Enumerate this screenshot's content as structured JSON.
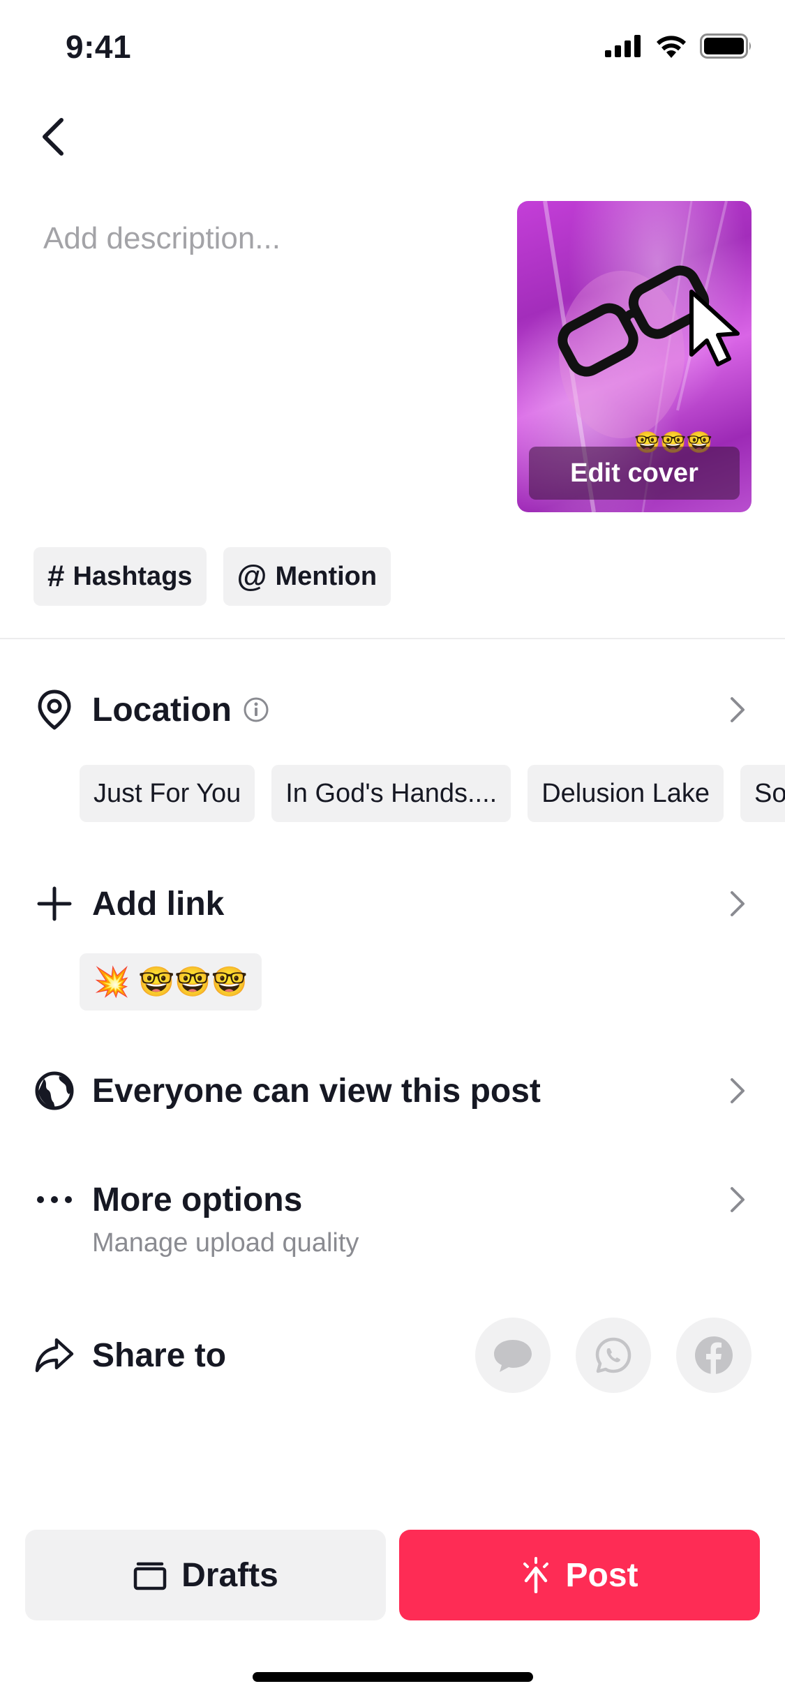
{
  "status_bar": {
    "time": "9:41"
  },
  "description": {
    "placeholder": "Add description..."
  },
  "cover": {
    "edit_label": "Edit cover",
    "emoji_overlay": "🤓🤓🤓"
  },
  "chips": [
    {
      "symbol": "#",
      "label": "Hashtags"
    },
    {
      "symbol": "@",
      "label": "Mention"
    }
  ],
  "location": {
    "label": "Location",
    "suggestions": [
      "Just For You",
      "In God's Hands....",
      "Delusion Lake",
      "So"
    ]
  },
  "add_link": {
    "label": "Add link",
    "chip_emojis": "💥 🤓🤓🤓"
  },
  "privacy": {
    "label": "Everyone can view this post"
  },
  "more_options": {
    "label": "More options",
    "sublabel": "Manage upload quality"
  },
  "share": {
    "label": "Share to",
    "targets": [
      "message-icon",
      "whatsapp-icon",
      "facebook-icon"
    ]
  },
  "actions": {
    "drafts_label": "Drafts",
    "post_label": "Post"
  },
  "colors": {
    "post_button": "#fe2c55",
    "chip_background": "#f1f1f2",
    "text": "#161823"
  }
}
